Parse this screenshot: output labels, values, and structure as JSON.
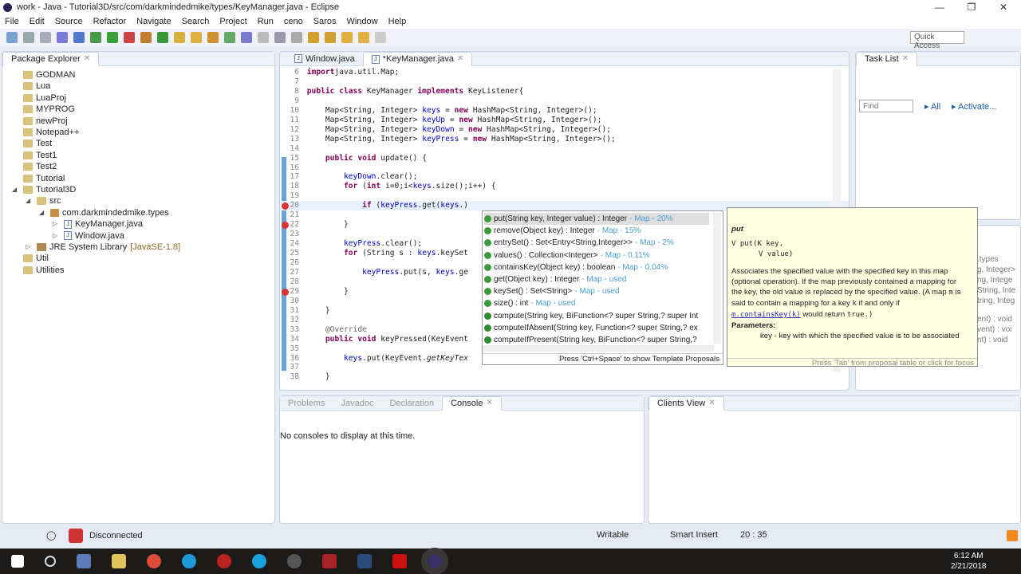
{
  "window": {
    "title": "work - Java - Tutorial3D/src/com/darkmindedmike/types/KeyManager.java - Eclipse"
  },
  "menu": [
    "File",
    "Edit",
    "Source",
    "Refactor",
    "Navigate",
    "Search",
    "Project",
    "Run",
    "ceno",
    "Saros",
    "Window",
    "Help"
  ],
  "toolbar": {
    "quick_access": "Quick Access"
  },
  "package_explorer": {
    "title": "Package Explorer",
    "items": [
      {
        "label": "GODMAN",
        "type": "project",
        "depth": 0
      },
      {
        "label": "Lua",
        "type": "project",
        "depth": 0
      },
      {
        "label": "LuaProj",
        "type": "project",
        "depth": 0
      },
      {
        "label": "MYPROG",
        "type": "project",
        "depth": 0
      },
      {
        "label": "newProj",
        "type": "project",
        "depth": 0
      },
      {
        "label": "Notepad++",
        "type": "project",
        "depth": 0
      },
      {
        "label": "Test",
        "type": "project",
        "depth": 0
      },
      {
        "label": "Test1",
        "type": "project",
        "depth": 0
      },
      {
        "label": "Test2",
        "type": "project",
        "depth": 0
      },
      {
        "label": "Tutorial",
        "type": "project",
        "depth": 0
      },
      {
        "label": "Tutorial3D",
        "type": "project",
        "depth": 0,
        "expanded": true
      },
      {
        "label": "src",
        "type": "folder",
        "depth": 1,
        "expanded": true
      },
      {
        "label": "com.darkmindedmike.types",
        "type": "package",
        "depth": 2,
        "expanded": true
      },
      {
        "label": "KeyManager.java",
        "type": "java",
        "depth": 3
      },
      {
        "label": "Window.java",
        "type": "java",
        "depth": 3
      },
      {
        "label": "JRE System Library",
        "suffix": "[JavaSE-1.8]",
        "type": "library",
        "depth": 1
      },
      {
        "label": "Util",
        "type": "project",
        "depth": 0
      },
      {
        "label": "Utilities",
        "type": "project",
        "depth": 0
      }
    ]
  },
  "editor": {
    "tabs": [
      {
        "label": "Window.java",
        "active": false
      },
      {
        "label": "*KeyManager.java",
        "active": true
      }
    ],
    "lines": [
      [
        6,
        [
          [
            "kw",
            "import"
          ],
          [
            "",
            "java.util.Map;"
          ]
        ]
      ],
      [
        7,
        []
      ],
      [
        8,
        [
          [
            "kw",
            "public class"
          ],
          [
            "",
            " KeyManager "
          ],
          [
            "kw",
            "implements"
          ],
          [
            "",
            " KeyListener{"
          ]
        ]
      ],
      [
        9,
        []
      ],
      [
        10,
        [
          [
            "",
            "    Map<String, Integer> "
          ],
          [
            "fld",
            "keys"
          ],
          [
            "",
            " = "
          ],
          [
            "kw",
            "new"
          ],
          [
            "",
            " HashMap<String, Integer>();"
          ]
        ]
      ],
      [
        11,
        [
          [
            "",
            "    Map<String, Integer> "
          ],
          [
            "fld",
            "keyUp"
          ],
          [
            "",
            " = "
          ],
          [
            "kw",
            "new"
          ],
          [
            "",
            " HashMap<String, Integer>();"
          ]
        ]
      ],
      [
        12,
        [
          [
            "",
            "    Map<String, Integer> "
          ],
          [
            "fld",
            "keyDown"
          ],
          [
            "",
            " = "
          ],
          [
            "kw",
            "new"
          ],
          [
            "",
            " HashMap<String, Integer>();"
          ]
        ]
      ],
      [
        13,
        [
          [
            "",
            "    Map<String, Integer> "
          ],
          [
            "fld",
            "keyPress"
          ],
          [
            "",
            " = "
          ],
          [
            "kw",
            "new"
          ],
          [
            "",
            " HashMap<String, Integer>();"
          ]
        ]
      ],
      [
        14,
        []
      ],
      [
        15,
        [
          [
            "",
            "    "
          ],
          [
            "kw",
            "public void"
          ],
          [
            "",
            " update() {"
          ]
        ]
      ],
      [
        16,
        []
      ],
      [
        17,
        [
          [
            "",
            "        "
          ],
          [
            "fld",
            "keyDown"
          ],
          [
            "",
            ".clear();"
          ]
        ]
      ],
      [
        18,
        [
          [
            "",
            "        "
          ],
          [
            "kw",
            "for"
          ],
          [
            "",
            " ("
          ],
          [
            "kw",
            "int"
          ],
          [
            "",
            " i=0;i<"
          ],
          [
            "fld",
            "keys"
          ],
          [
            "",
            ".size();i++) {"
          ]
        ]
      ],
      [
        19,
        []
      ],
      [
        20,
        [
          [
            "",
            "            "
          ],
          [
            "kw",
            "if"
          ],
          [
            "",
            " ("
          ],
          [
            "fld",
            "keyPress"
          ],
          [
            "",
            ".get("
          ],
          [
            "fld",
            "keys"
          ],
          [
            "",
            ".)"
          ]
        ]
      ],
      [
        21,
        []
      ],
      [
        22,
        [
          [
            "",
            "        }"
          ]
        ]
      ],
      [
        23,
        []
      ],
      [
        24,
        [
          [
            "",
            "        "
          ],
          [
            "fld",
            "keyPress"
          ],
          [
            "",
            ".clear();"
          ]
        ]
      ],
      [
        25,
        [
          [
            "",
            "        "
          ],
          [
            "kw",
            "for"
          ],
          [
            "",
            " (String s : "
          ],
          [
            "fld",
            "keys"
          ],
          [
            "",
            ".keySet"
          ]
        ]
      ],
      [
        26,
        []
      ],
      [
        27,
        [
          [
            "",
            "            "
          ],
          [
            "fld",
            "keyPress"
          ],
          [
            "",
            ".put(s, "
          ],
          [
            "fld",
            "keys"
          ],
          [
            "",
            ".ge"
          ]
        ]
      ],
      [
        28,
        []
      ],
      [
        29,
        [
          [
            "",
            "        }"
          ]
        ]
      ],
      [
        30,
        []
      ],
      [
        31,
        [
          [
            "",
            "    }"
          ]
        ]
      ],
      [
        32,
        []
      ],
      [
        33,
        [
          [
            "",
            "    "
          ],
          [
            "ann",
            "@Override"
          ]
        ]
      ],
      [
        34,
        [
          [
            "",
            "    "
          ],
          [
            "kw",
            "public void"
          ],
          [
            "",
            " keyPressed(KeyEvent"
          ]
        ]
      ],
      [
        35,
        []
      ],
      [
        36,
        [
          [
            "",
            "        "
          ],
          [
            "fld",
            "keys"
          ],
          [
            "",
            ".put(KeyEvent."
          ],
          [
            "it",
            "getKeyTex"
          ]
        ]
      ],
      [
        37,
        []
      ],
      [
        38,
        [
          [
            "",
            "    }"
          ]
        ]
      ]
    ]
  },
  "content_assist": {
    "proposals": [
      {
        "sig": "put(String key, Integer value) : Integer",
        "meta": " - Map - 20%"
      },
      {
        "sig": "remove(Object key) : Integer",
        "meta": " - Map - 15%"
      },
      {
        "sig": "entrySet() : Set<Entry<String,Integer>>",
        "meta": " - Map - 2%"
      },
      {
        "sig": "values() : Collection<Integer>",
        "meta": " - Map - 0.11%"
      },
      {
        "sig": "containsKey(Object key) : boolean",
        "meta": " - Map - 0.04%"
      },
      {
        "sig": "get(Object key) : Integer",
        "meta": " - Map - used"
      },
      {
        "sig": "keySet() : Set<String>",
        "meta": " - Map - used"
      },
      {
        "sig": "size() : int",
        "meta": " - Map - used"
      },
      {
        "sig": "compute(String key, BiFunction<? super String,? super Int",
        "meta": ""
      },
      {
        "sig": "computeIfAbsent(String key, Function<? super String,? ex",
        "meta": ""
      },
      {
        "sig": "computeIfPresent(String key, BiFunction<? super String,?",
        "meta": ""
      }
    ],
    "footer": "Press 'Ctrl+Space' to show Template Proposals"
  },
  "javadoc": {
    "name": "put",
    "sig1": "V put(K key,",
    "sig2": "V value)",
    "desc_a": "Associates the specified value with the specified key in this map (optional operation). If the map previously contained a mapping for the key, the old value is replaced by the specified value. (A map ",
    "m": "m",
    "desc_b": " is said to contain a mapping for a key ",
    "k": "k",
    "desc_c": " if and only if ",
    "link": "m.containsKey(k)",
    "desc_d": " would return ",
    "true": "true.)",
    "params_label": "Parameters:",
    "param": "key - key with which the specified value is to be associated",
    "footer": "Press 'Tab' from proposal table or click for focus"
  },
  "task_list": {
    "title": "Task List",
    "find_placeholder": "Find",
    "all": "All",
    "activate": "Activate..."
  },
  "outline": {
    "partial": [
      ".types",
      "g, Integer>",
      "ng, Intege",
      "String, Inte",
      "tring, Integ",
      "ent) : void",
      "vent) : voi",
      "nt) : void"
    ]
  },
  "bottom": {
    "tabs": [
      "Problems",
      "Javadoc",
      "Declaration",
      "Console"
    ],
    "console_msg": "No consoles to display at this time.",
    "clients_view": "Clients View"
  },
  "status": {
    "connection": "Disconnected",
    "writable": "Writable",
    "insert": "Smart Insert",
    "position": "20 : 35"
  },
  "taskbar": {
    "time": "6:12 AM",
    "date": "2/21/2018"
  }
}
